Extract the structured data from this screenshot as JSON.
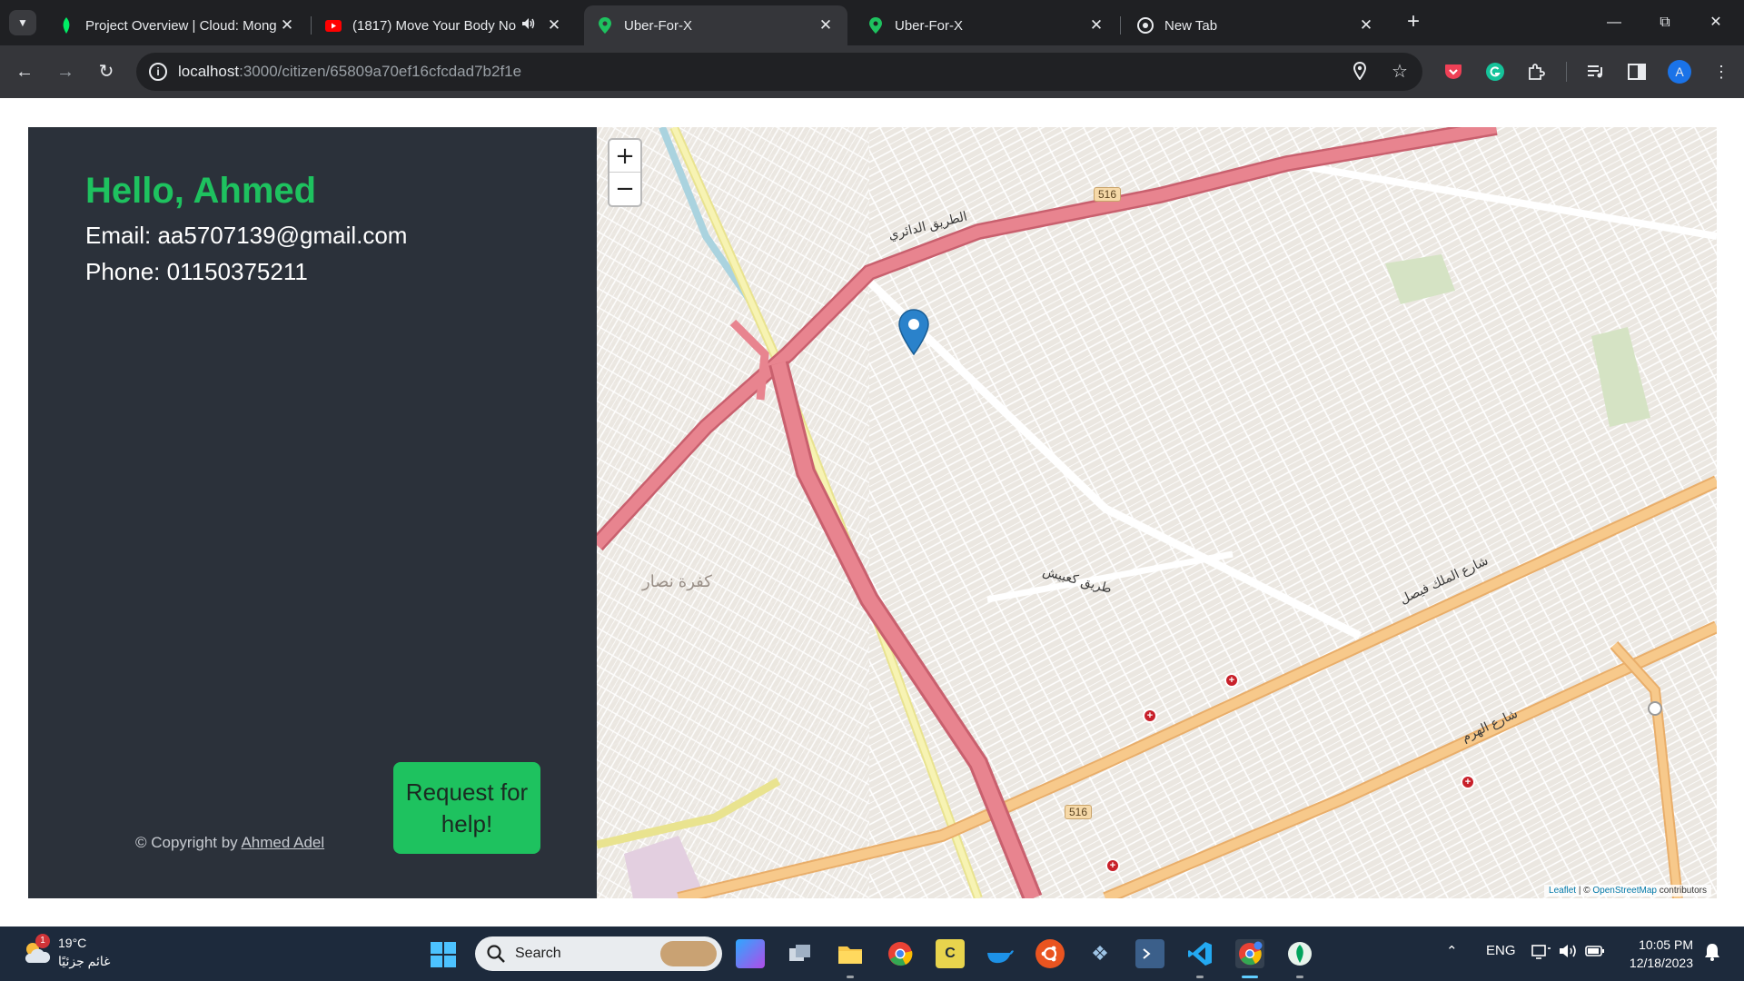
{
  "browser": {
    "tabs": [
      {
        "title": "Project Overview | Cloud: Mong",
        "favicon": "mongodb-leaf-icon",
        "active": false
      },
      {
        "title": "(1817) Move Your Body No",
        "favicon": "youtube-icon",
        "active": false,
        "audio": true
      },
      {
        "title": "Uber-For-X",
        "favicon": "map-pin-icon",
        "active": true
      },
      {
        "title": "Uber-For-X",
        "favicon": "map-pin-icon",
        "active": false
      },
      {
        "title": "New Tab",
        "favicon": "chrome-icon",
        "active": false
      }
    ],
    "url_host": "localhost",
    "url_path": ":3000/citizen/65809a70ef16cfcdad7b2f1e",
    "profile_initial": "A"
  },
  "page": {
    "greeting": "Hello, Ahmed",
    "email_line": "Email: aa5707139@gmail.com",
    "phone_line": "Phone: 01150375211",
    "help_button": "Request for help!",
    "copyright_prefix": "© Copyright by ",
    "copyright_author": "Ahmed Adel"
  },
  "map": {
    "zoom_in": "+",
    "zoom_out": "−",
    "attribution_leaflet": "Leaflet",
    "attribution_sep": " | © ",
    "attribution_osm": "OpenStreetMap",
    "attribution_suffix": " contributors",
    "route_shield_1": "516",
    "route_shield_2": "516",
    "place_label": "كفرة نصار",
    "road_ring": "الطريق الدائري",
    "road_faisal": "شارع الملك فيصل",
    "road_haram": "شارع الهرم",
    "road_kabsh": "طريق كعبيش"
  },
  "taskbar": {
    "weather_temp": "19°C",
    "weather_desc": "غائم جزئيًا",
    "weather_badge": "1",
    "search_placeholder": "Search",
    "language": "ENG",
    "time": "10:05 PM",
    "date": "12/18/2023",
    "apps": [
      "copilot-icon",
      "task-view-icon",
      "file-explorer-icon",
      "chrome-icon",
      "app-icon",
      "docker-icon",
      "ubuntu-icon",
      "mysql-icon",
      "terminal-icon",
      "vscode-icon",
      "chrome-dev-icon",
      "mongodb-compass-icon"
    ]
  },
  "colors": {
    "accent_green": "#1ec25f",
    "panel_bg": "#2b313a",
    "ring_road": "#e8848f",
    "main_road": "#f7c98b"
  }
}
